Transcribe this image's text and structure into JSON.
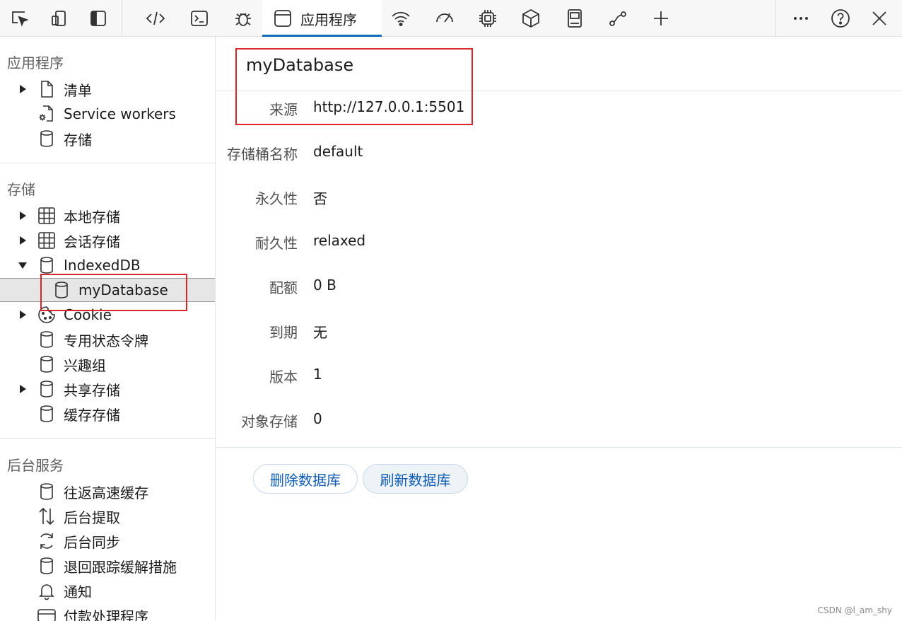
{
  "toolbar": {
    "active_tab": "应用程序",
    "icons": [
      "inspect-icon",
      "device-emulation-icon",
      "sidebar-toggle-icon",
      "elements-icon",
      "console-icon",
      "debug-icon",
      "application-icon",
      "network-icon",
      "performance-icon",
      "memory-icon",
      "3d-view-icon",
      "issues-icon",
      "flows-icon",
      "add-tool-icon",
      "more-icon",
      "help-icon",
      "close-icon"
    ]
  },
  "sidebar": {
    "app_section": {
      "title": "应用程序",
      "items": [
        {
          "label": "清单",
          "icon": "file-icon",
          "expandable": true
        },
        {
          "label": "Service workers",
          "icon": "gear-file-icon",
          "expandable": false
        },
        {
          "label": "存储",
          "icon": "database-icon",
          "expandable": false
        }
      ]
    },
    "storage_section": {
      "title": "存储",
      "items": [
        {
          "label": "本地存储",
          "icon": "grid-icon",
          "expandable": true
        },
        {
          "label": "会话存储",
          "icon": "grid-icon",
          "expandable": true
        },
        {
          "label": "IndexedDB",
          "icon": "database-icon",
          "expandable": true,
          "expanded": true
        },
        {
          "label": "myDatabase",
          "icon": "database-icon",
          "selected": true
        },
        {
          "label": "Cookie",
          "icon": "cookie-icon",
          "expandable": true
        },
        {
          "label": "专用状态令牌",
          "icon": "database-icon"
        },
        {
          "label": "兴趣组",
          "icon": "database-icon"
        },
        {
          "label": "共享存储",
          "icon": "database-icon",
          "expandable": true
        },
        {
          "label": "缓存存储",
          "icon": "database-icon"
        }
      ]
    },
    "bg_section": {
      "title": "后台服务",
      "items": [
        {
          "label": "往返高速缓存",
          "icon": "database-icon"
        },
        {
          "label": "后台提取",
          "icon": "up-down-arrows-icon"
        },
        {
          "label": "后台同步",
          "icon": "sync-icon"
        },
        {
          "label": "退回跟踪缓解措施",
          "icon": "database-icon"
        },
        {
          "label": "通知",
          "icon": "bell-icon"
        },
        {
          "label": "付款处理程序",
          "icon": "card-icon"
        }
      ]
    }
  },
  "main": {
    "db_name": "myDatabase",
    "fields": [
      {
        "key": "来源",
        "value": "http://127.0.0.1:5501"
      },
      {
        "key": "存储桶名称",
        "value": "default"
      },
      {
        "key": "永久性",
        "value": "否"
      },
      {
        "key": "耐久性",
        "value": "relaxed"
      },
      {
        "key": "配额",
        "value": "0 B"
      },
      {
        "key": "到期",
        "value": "无"
      },
      {
        "key": "版本",
        "value": "1"
      },
      {
        "key": "对象存储",
        "value": "0"
      }
    ],
    "delete_button": "删除数据库",
    "refresh_button": "刷新数据库"
  },
  "watermark": "CSDN @l_am_shy",
  "colors": {
    "accent": "#0f6cbd",
    "highlight_box": "#d9262c",
    "button_text": "#0f5cb3"
  }
}
